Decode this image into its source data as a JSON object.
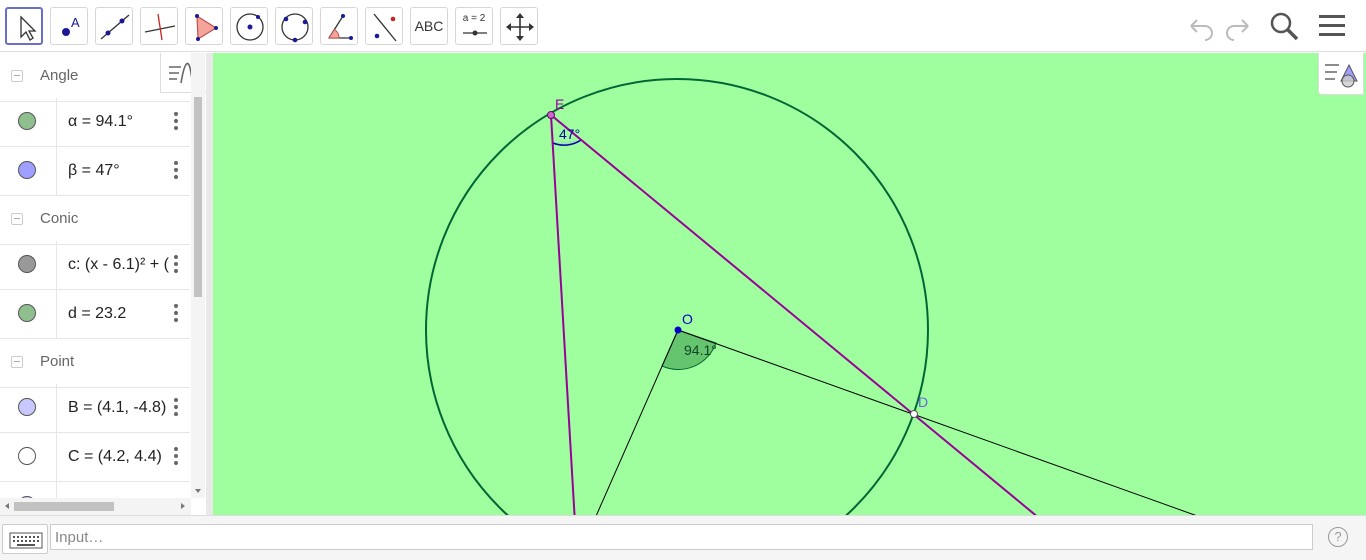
{
  "toolbar": {
    "tools": [
      {
        "name": "move-tool",
        "icon": "arrow-pointer-icon",
        "active": true
      },
      {
        "name": "point-tool",
        "icon": "point-icon"
      },
      {
        "name": "line-tool",
        "icon": "line-icon"
      },
      {
        "name": "perpendicular-tool",
        "icon": "perpendicular-line-icon"
      },
      {
        "name": "polygon-tool",
        "icon": "polygon-icon"
      },
      {
        "name": "circle-center-tool",
        "icon": "circle-center-icon"
      },
      {
        "name": "circle-three-points-tool",
        "icon": "circle-three-points-icon"
      },
      {
        "name": "angle-tool",
        "icon": "angle-icon"
      },
      {
        "name": "reflect-tool",
        "icon": "reflect-icon"
      },
      {
        "name": "text-tool",
        "icon": "text-icon",
        "label": "ABC"
      },
      {
        "name": "slider-tool",
        "icon": "slider-icon",
        "label": "a = 2"
      },
      {
        "name": "move-view-tool",
        "icon": "move-graphics-icon"
      }
    ],
    "undo_icon": "undo-icon",
    "redo_icon": "redo-icon",
    "search_icon": "search-icon",
    "menu_icon": "hamburger-menu-icon"
  },
  "algebra": {
    "groups": [
      {
        "label": "Angle",
        "items": [
          {
            "expr": "α = 94.1°",
            "color": "#8fbf8f"
          },
          {
            "expr": "β = 47°",
            "color": "#9f9fff"
          }
        ]
      },
      {
        "label": "Conic",
        "items": [
          {
            "expr": "c: (x - 6.1)² + (",
            "color": "#999999"
          },
          {
            "expr": "d = 23.2",
            "color": "#8fbf8f"
          }
        ]
      },
      {
        "label": "Point",
        "items": [
          {
            "expr": "B = (4.1, -4.8)",
            "color": "#c8c8ff"
          },
          {
            "expr": "C = (4.2, 4.4)",
            "color": "#ffffff"
          }
        ]
      }
    ]
  },
  "graphics": {
    "labels": {
      "E": "E",
      "O": "O",
      "D": "D"
    },
    "angle_alpha": "94.1°",
    "angle_beta": "47°",
    "colors": {
      "background": "#9fff9f",
      "circle": "#006633",
      "chord": "#990099",
      "line": "#000000",
      "point_blue": "#0000cc",
      "angle_fill": "#3f9f4f"
    }
  },
  "inputbar": {
    "placeholder": "Input…",
    "keyboard_icon": "keyboard-icon",
    "help_icon": "help-icon",
    "help_text": "?"
  }
}
